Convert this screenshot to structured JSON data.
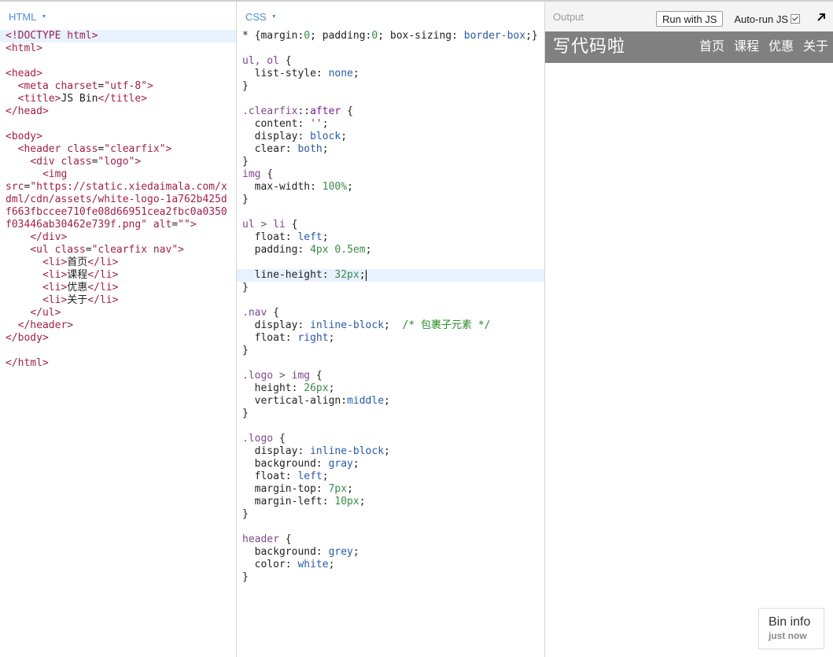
{
  "panels": {
    "html_label": "HTML",
    "css_label": "CSS",
    "output_label": "Output"
  },
  "output_controls": {
    "run_button": "Run with JS",
    "autorun_label": "Auto-run JS",
    "autorun_checked": true
  },
  "html_code": [
    [
      [
        "tag",
        "<!DOCTYPE html>"
      ]
    ],
    [
      [
        "tag",
        "<html>"
      ]
    ],
    [],
    [
      [
        "tag",
        "<head>"
      ]
    ],
    [
      [
        "plain",
        "  "
      ],
      [
        "tag",
        "<meta "
      ],
      [
        "attr",
        "charset"
      ],
      [
        "plain",
        "="
      ],
      [
        "str",
        "\"utf-8\""
      ],
      [
        "tag",
        ">"
      ]
    ],
    [
      [
        "plain",
        "  "
      ],
      [
        "tag",
        "<title>"
      ],
      [
        "plain",
        "JS Bin"
      ],
      [
        "tag",
        "</title>"
      ]
    ],
    [
      [
        "tag",
        "</head>"
      ]
    ],
    [],
    [
      [
        "tag",
        "<body>"
      ]
    ],
    [
      [
        "plain",
        "  "
      ],
      [
        "tag",
        "<header "
      ],
      [
        "attr",
        "class"
      ],
      [
        "plain",
        "="
      ],
      [
        "str",
        "\"clearfix\""
      ],
      [
        "tag",
        ">"
      ]
    ],
    [
      [
        "plain",
        "    "
      ],
      [
        "tag",
        "<div "
      ],
      [
        "attr",
        "class"
      ],
      [
        "plain",
        "="
      ],
      [
        "str",
        "\"logo\""
      ],
      [
        "tag",
        ">"
      ]
    ],
    [
      [
        "plain",
        "      "
      ],
      [
        "tag",
        "<img"
      ]
    ],
    [
      [
        "attr",
        "src"
      ],
      [
        "plain",
        "="
      ],
      [
        "str",
        "\"https://static.xiedaimala.com/xdml/cdn/assets/white-logo-1a762b425df663fbccee710fe08d66951cea2fbc0a0350f03446ab30462e739f.png\""
      ],
      [
        "plain",
        " "
      ],
      [
        "attr",
        "alt"
      ],
      [
        "plain",
        "="
      ],
      [
        "str",
        "\"\""
      ],
      [
        "tag",
        ">"
      ]
    ],
    [
      [
        "plain",
        "    "
      ],
      [
        "tag",
        "</div>"
      ]
    ],
    [
      [
        "plain",
        "    "
      ],
      [
        "tag",
        "<ul "
      ],
      [
        "attr",
        "class"
      ],
      [
        "plain",
        "="
      ],
      [
        "str",
        "\"clearfix nav\""
      ],
      [
        "tag",
        ">"
      ]
    ],
    [
      [
        "plain",
        "      "
      ],
      [
        "tag",
        "<li>"
      ],
      [
        "plain",
        "首页"
      ],
      [
        "tag",
        "</li>"
      ]
    ],
    [
      [
        "plain",
        "      "
      ],
      [
        "tag",
        "<li>"
      ],
      [
        "plain",
        "课程"
      ],
      [
        "tag",
        "</li>"
      ]
    ],
    [
      [
        "plain",
        "      "
      ],
      [
        "tag",
        "<li>"
      ],
      [
        "plain",
        "优惠"
      ],
      [
        "tag",
        "</li>"
      ]
    ],
    [
      [
        "plain",
        "      "
      ],
      [
        "tag",
        "<li>"
      ],
      [
        "plain",
        "关于"
      ],
      [
        "tag",
        "</li>"
      ]
    ],
    [
      [
        "plain",
        "    "
      ],
      [
        "tag",
        "</ul>"
      ]
    ],
    [
      [
        "plain",
        "  "
      ],
      [
        "tag",
        "</header>"
      ]
    ],
    [
      [
        "tag",
        "</body>"
      ]
    ],
    [],
    [
      [
        "tag",
        "</html>"
      ]
    ]
  ],
  "css_code": [
    [
      [
        "plain",
        "* {margin:"
      ],
      [
        "num",
        "0"
      ],
      [
        "plain",
        "; padding:"
      ],
      [
        "num",
        "0"
      ],
      [
        "plain",
        "; box-sizing: "
      ],
      [
        "val",
        "border-box"
      ],
      [
        "plain",
        ";}"
      ]
    ],
    [],
    [
      [
        "sel",
        "ul, ol"
      ],
      [
        "plain",
        " {"
      ]
    ],
    [
      [
        "plain",
        "  list-style: "
      ],
      [
        "val",
        "none"
      ],
      [
        "plain",
        ";"
      ]
    ],
    [
      [
        "plain",
        "}"
      ]
    ],
    [],
    [
      [
        "sel",
        ".clearfix"
      ],
      [
        "plain",
        "::"
      ],
      [
        "kw",
        "after"
      ],
      [
        "plain",
        " {"
      ]
    ],
    [
      [
        "plain",
        "  content: "
      ],
      [
        "str",
        "''"
      ],
      [
        "plain",
        ";"
      ]
    ],
    [
      [
        "plain",
        "  display: "
      ],
      [
        "val",
        "block"
      ],
      [
        "plain",
        ";"
      ]
    ],
    [
      [
        "plain",
        "  clear: "
      ],
      [
        "val",
        "both"
      ],
      [
        "plain",
        ";"
      ]
    ],
    [
      [
        "plain",
        "}"
      ]
    ],
    [
      [
        "sel",
        "img"
      ],
      [
        "plain",
        " {"
      ]
    ],
    [
      [
        "plain",
        "  max-width: "
      ],
      [
        "num",
        "100%"
      ],
      [
        "plain",
        ";"
      ]
    ],
    [
      [
        "plain",
        "}"
      ]
    ],
    [],
    [
      [
        "sel",
        "ul > li"
      ],
      [
        "plain",
        " {"
      ]
    ],
    [
      [
        "plain",
        "  float: "
      ],
      [
        "val",
        "left"
      ],
      [
        "plain",
        ";"
      ]
    ],
    [
      [
        "plain",
        "  padding: "
      ],
      [
        "num",
        "4px 0.5em"
      ],
      [
        "plain",
        ";"
      ]
    ],
    [],
    [
      [
        "plain",
        "  line-height: "
      ],
      [
        "num",
        "32px"
      ],
      [
        "plain",
        ";"
      ],
      [
        "cursor",
        ""
      ]
    ],
    [
      [
        "plain",
        "}"
      ]
    ],
    [],
    [
      [
        "sel",
        ".nav"
      ],
      [
        "plain",
        " {"
      ]
    ],
    [
      [
        "plain",
        "  display: "
      ],
      [
        "val",
        "inline-block"
      ],
      [
        "plain",
        ";  "
      ],
      [
        "cmt",
        "/* 包裹子元素 */"
      ]
    ],
    [
      [
        "plain",
        "  float: "
      ],
      [
        "val",
        "right"
      ],
      [
        "plain",
        ";"
      ]
    ],
    [
      [
        "plain",
        "}"
      ]
    ],
    [],
    [
      [
        "sel",
        ".logo > img"
      ],
      [
        "plain",
        " {"
      ]
    ],
    [
      [
        "plain",
        "  height: "
      ],
      [
        "num",
        "26px"
      ],
      [
        "plain",
        ";"
      ]
    ],
    [
      [
        "plain",
        "  vertical-align:"
      ],
      [
        "val",
        "middle"
      ],
      [
        "plain",
        ";"
      ]
    ],
    [
      [
        "plain",
        "}"
      ]
    ],
    [],
    [
      [
        "sel",
        ".logo"
      ],
      [
        "plain",
        " {"
      ]
    ],
    [
      [
        "plain",
        "  display: "
      ],
      [
        "val",
        "inline-block"
      ],
      [
        "plain",
        ";"
      ]
    ],
    [
      [
        "plain",
        "  background: "
      ],
      [
        "val",
        "gray"
      ],
      [
        "plain",
        ";"
      ]
    ],
    [
      [
        "plain",
        "  float: "
      ],
      [
        "val",
        "left"
      ],
      [
        "plain",
        ";"
      ]
    ],
    [
      [
        "plain",
        "  margin-top: "
      ],
      [
        "num",
        "7px"
      ],
      [
        "plain",
        ";"
      ]
    ],
    [
      [
        "plain",
        "  margin-left: "
      ],
      [
        "num",
        "10px"
      ],
      [
        "plain",
        ";"
      ]
    ],
    [
      [
        "plain",
        "}"
      ]
    ],
    [],
    [
      [
        "sel",
        "header"
      ],
      [
        "plain",
        " {"
      ]
    ],
    [
      [
        "plain",
        "  background: "
      ],
      [
        "val",
        "grey"
      ],
      [
        "plain",
        ";"
      ]
    ],
    [
      [
        "plain",
        "  color: "
      ],
      [
        "val",
        "white"
      ],
      [
        "plain",
        ";"
      ]
    ],
    [
      [
        "plain",
        "}"
      ]
    ]
  ],
  "css_highlight_line": 19,
  "html_highlight_line": 0,
  "preview": {
    "logo_text": "写代码啦",
    "nav": [
      "首页",
      "课程",
      "优惠",
      "关于"
    ]
  },
  "bin_info": {
    "title": "Bin info",
    "subtitle": "just now"
  },
  "colors": {
    "accent": "#4a90d9",
    "header_bg": "#808080",
    "highlight_line": "#e8f2ff"
  }
}
